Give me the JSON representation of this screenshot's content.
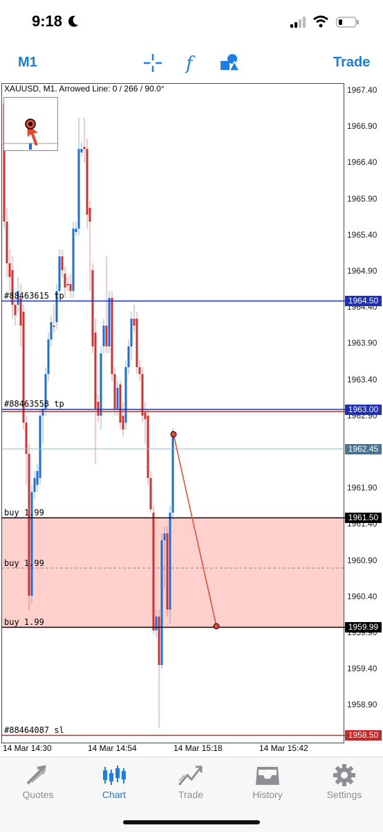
{
  "status": {
    "time": "9:18"
  },
  "toolbar": {
    "timeframe": "M1",
    "trade": "Trade",
    "crosshair_icon": "crosshair-icon",
    "indicators_icon": "function-icon",
    "objects_icon": "shapes-icon"
  },
  "chart": {
    "title": "XAUUSD, M1. Arrowed Line: 0 / 266 / 90.0°",
    "price_ticks": [
      "1967.40",
      "1966.90",
      "1966.40",
      "1965.90",
      "1965.40",
      "1964.90",
      "1964.40",
      "1963.90",
      "1963.40",
      "1962.90",
      "1961.90",
      "1961.40",
      "1960.90",
      "1960.40",
      "1959.90",
      "1959.40",
      "1958.90"
    ],
    "time_ticks": [
      "14 Mar 14:30",
      "14 Mar 14:54",
      "14 Mar 15:18",
      "14 Mar 15:42"
    ],
    "levels": {
      "tp1": {
        "label": "#88463615 tp",
        "price": "1964.50",
        "color": "#1f2fb3"
      },
      "tp2": {
        "label": "#88463558 tp",
        "price": "1963.00",
        "color": "#1f2fb3"
      },
      "bid": {
        "price": "1962.45",
        "color": "#4a7391"
      },
      "buy1": {
        "label": "buy 1.99",
        "price": "1961.50"
      },
      "buy2": {
        "label": "buy 1.99"
      },
      "buy3": {
        "label": "buy 1.99",
        "price": "1959.99"
      },
      "sl": {
        "label": "#88464087 sl",
        "price": "1958.50",
        "color": "#c62828"
      }
    },
    "up_color": "#1a6fd6",
    "down_color": "#d32f2f",
    "zone_color": "#ffd0cc",
    "arrow_color": "#e8472d"
  },
  "tabs": [
    {
      "label": "Quotes",
      "icon": "quotes-arrows-icon"
    },
    {
      "label": "Chart",
      "icon": "candlestick-chart-icon"
    },
    {
      "label": "Trade",
      "icon": "trade-trend-icon"
    },
    {
      "label": "History",
      "icon": "history-inbox-icon"
    },
    {
      "label": "Settings",
      "icon": "settings-gear-icon"
    }
  ]
}
